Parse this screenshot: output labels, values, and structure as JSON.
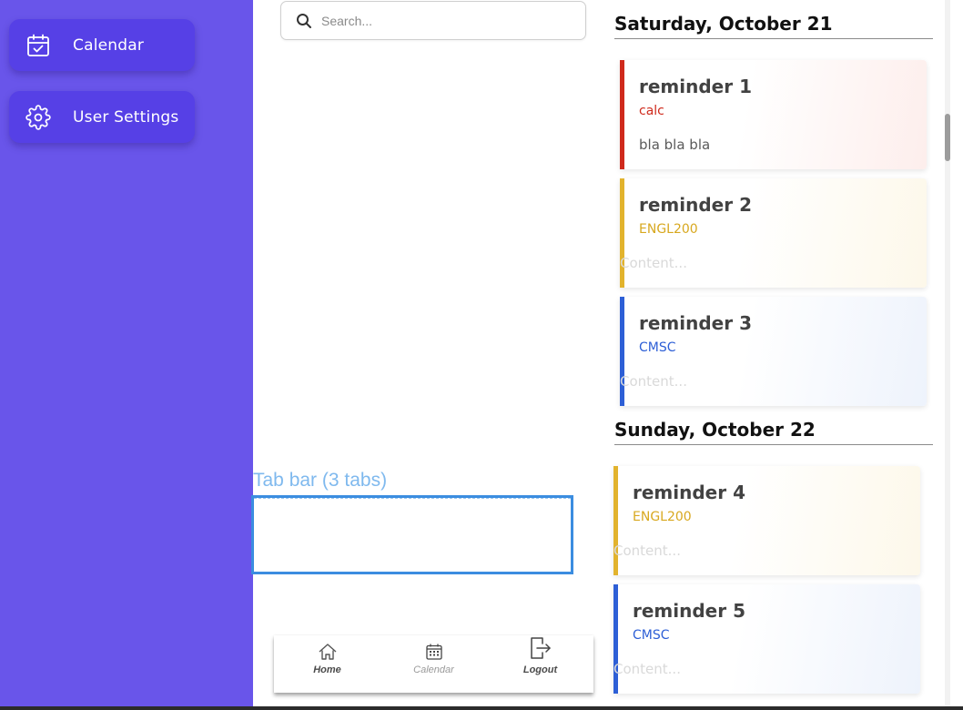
{
  "sidebar": {
    "items": [
      {
        "label": "Calendar",
        "icon": "calendar-check-icon"
      },
      {
        "label": "User Settings",
        "icon": "gear-icon"
      }
    ],
    "background": "#6955ea",
    "button_color": "#5640e6"
  },
  "search": {
    "placeholder": "Search...",
    "value": "",
    "icon": "search-icon"
  },
  "tab_bar_placeholder": {
    "label": "Tab bar (3 tabs)"
  },
  "tab_bar": {
    "tabs": [
      {
        "label": "Home",
        "icon": "home-icon",
        "active": true
      },
      {
        "label": "Calendar",
        "icon": "calendar-grid-icon",
        "active": false
      },
      {
        "label": "Logout",
        "icon": "logout-icon",
        "active": false
      }
    ]
  },
  "days": [
    {
      "heading": "Saturday, October 21",
      "reminders": [
        {
          "title": "reminder 1",
          "course": "calc",
          "content": "bla bla bla",
          "content_is_placeholder": false,
          "color": "#cf2a1c"
        },
        {
          "title": "reminder 2",
          "course": "ENGL200",
          "content": "Content...",
          "content_is_placeholder": true,
          "color": "#e2b32d"
        },
        {
          "title": "reminder 3",
          "course": "CMSC",
          "content": "Content...",
          "content_is_placeholder": true,
          "color": "#2d5fd6"
        }
      ]
    },
    {
      "heading": "Sunday, October 22",
      "reminders": [
        {
          "title": "reminder 4",
          "course": "ENGL200",
          "content": "Content...",
          "content_is_placeholder": true,
          "color": "#e2b32d"
        },
        {
          "title": "reminder 5",
          "course": "CMSC",
          "content": "Content...",
          "content_is_placeholder": true,
          "color": "#2d5fd6"
        }
      ]
    }
  ]
}
